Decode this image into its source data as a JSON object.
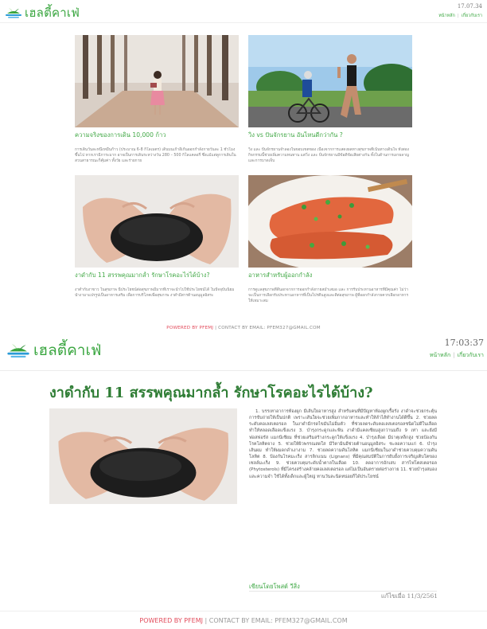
{
  "site": {
    "brand": "เฮลตี้คาเฟ่",
    "brand_color": "#3aa640",
    "logo_icon": "leaf-island-logo-icon"
  },
  "listing_page": {
    "time": "17.07.34",
    "nav": {
      "home": "หน้าหลัก",
      "about": "เกี่ยวกับเรา"
    },
    "cards": [
      {
        "title": "ความจริงของการเดิน 10,000 ก้าว",
        "excerpt": "การเดินวันละหนึ่งหมื่นก้าว (ประมาณ 6-8 กิโลเมตร) เดินบนเก้าอี้เก้นออกกำลังกายวันละ 1 ชั่วโมงขึ้นไป หากเรามีภาระมาก อาจเป็นการเดินระหว่างวัน 280 – 500 กิโลแคลอรี่ ซึ่งแม้แต่ดูการเดินในสวนสาธารณะก็คุ้มค่า ทั้งวัย และร่ายกาย",
        "image": "woman-reading-in-forest-photo"
      },
      {
        "title": "วิ่ง vs ปั่นจักรยาน อันไหนดีกว่ากัน ?",
        "excerpt": "วิ่ง และ ปั่นจักรยานจำลองในขอบเขตของ เนื่องจากการแสดงผลทางสุขภาพที่เน้นทางเดินใจ ทั้งสองกิจกรรมนี้ช่วยเพิ่มความทนทาน แต่วิ่ง และ ปั่นจักรยานมีข้อดีข้อเสียต่างกัน ทั้งในด้านการเผาผลาญ และการบาดเจ็บ",
        "image": "runner-and-cyclist-photo"
      },
      {
        "title": "งาดำกับ 11 สรรพคุณมากล้ำ รักษาโรคอะไรได้บ้าง?",
        "excerpt": "งาดำกับงาขาว ในสุขภาพ นี้ประโยชน์ต่อสุขภาพมีมากที่เราจะนำไปใช้ประโยชน์ได้ ในปัจจุบันนิยมนำงามาแปรรูปเป็นอาหารเสริม เพื่อการบริโภคเพื่อสุขภาพ งาดำมีสารต้านอนุมูลอิสระ",
        "image": "black-sesame-in-hands-photo"
      },
      {
        "title": "อาหารสำหรับผู้ออกกำลัง",
        "excerpt": "การดูแลสุขภาพที่ดีนอกจากการออกกำลังกายสม่ำเสมอ และ การรับประทานอาหารที่มีคุณค่า ไม่ว่าจะเป็นการเลือกรับประทานอาหารที่เป็นโปรตีนสูงและดีต่อสุขภาพ ผู้ที่ออกกำลังกายควรเลือกอาหารให้เหมาะสม",
        "image": "grilled-salmon-plate-photo"
      }
    ],
    "footer": {
      "powered": "POWERED BY PFEMJ",
      "contact": " | CONTACT BY EMAIL: PFEM327@GMAIL.COM"
    }
  },
  "article_page": {
    "time": "17:03:37",
    "nav": {
      "home": "หน้าหลัก",
      "about": "เกี่ยวกับเรา"
    },
    "headline": "งาดำกับ 11 สรรพคุณมากล้ำ รักษาโรคอะไรได้บ้าง?",
    "image": "black-sesame-in-hands-photo",
    "body": "1. บรรเทาอาการท้องผูก มีเส้นใยอาหารสูง สำหรับคนที่มีปัญหาท้องผูกเรื้อรัง งาดำจะช่วยกระตุ้นการขับถ่ายให้เป็นปกติ เพราะเส้นใยจะช่วยเพิ่มกากอาหารและทำให้ลำไส้ทำงานได้ดีขึ้น 2. ช่วยลดระดับคอเลสเตอรอล ในงาดำมีกรดไขมันไม่อิ่มตัว ที่ช่วยลดระดับคอเลสเตอรอลชนิดไม่ดีในเลือด ทำให้หลอดเลือดแข็งแรง 3. บำรุงกระดูกและฟัน งาดำมีแคลเซียมสูงกว่านมถึง 9 เท่า และยังมีฟอสฟอรัส แมกนีเซียม ที่ช่วยเสริมสร้างกระดูกให้แข็งแรง 4. บำรุงเลือด มีธาตุเหล็กสูง ช่วยป้องกันโรคโลหิตจาง 5. ช่วยให้ผิวพรรณสดใส มีวิตามินอีช่วยต้านอนุมูลอิสระ ชะลอความแก่ 6. บำรุงเส้นผม ทำให้ผมดกดำเงางาม 7. ช่วยลดความดันโลหิต แมกนีเซียมในงาดำช่วยควบคุมความดันโลหิต 8. ป้องกันโรคมะเร็ง สารลิกแนน (Lignans) ที่มีคุณสมบัติในการยับยั้งการเจริญเติบโตของเซลล์มะเร็ง 9. ช่วยควบคุมระดับน้ำตาลในเลือด 10. ลดอาการอักเสบ สารไฟโตสเตอรอล (Phytosterols) ที่มีโครงสร้างคล้ายคอเลสเตอรอล แต่ไม่เป็นอันตรายต่อร่างกาย 11. ช่วยบำรุงสมอง และความจำ ใช้ได้ทั้งเด็กและผู้ใหญ่ ทานวันละนิดหน่อยก็ได้ประโยชน์",
    "author": "เขียนโดยโพสต์ วีสิ่ง",
    "edited": "แก้ไขเมื่อ 11/3/2561",
    "footer": {
      "powered": "POWERED BY PFEMJ",
      "contact": " | CONTACT BY EMAIL: PFEM327@GMAIL.COM"
    }
  }
}
